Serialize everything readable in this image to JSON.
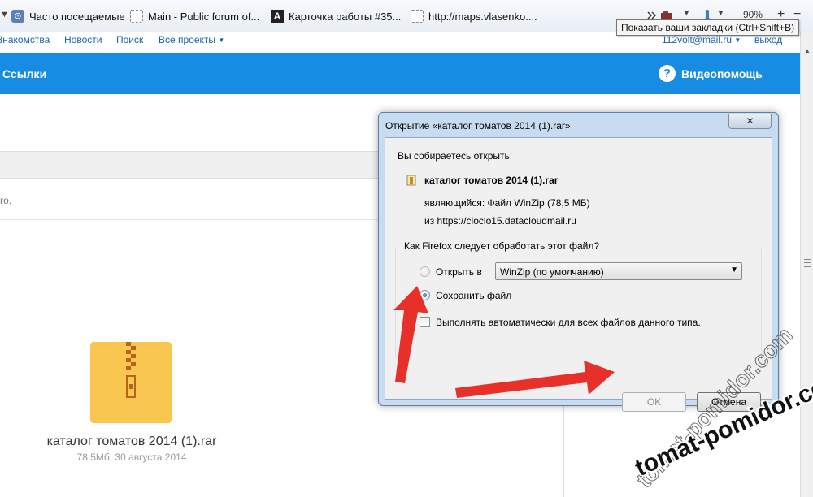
{
  "bookmarks_bar": {
    "items": [
      {
        "label": "Часто посещаемые",
        "icon": "most-visited-icon"
      },
      {
        "label": "Main - Public forum of...",
        "icon": "page-icon"
      },
      {
        "label": "Карточка работы #35...",
        "icon": "a-logo-icon"
      },
      {
        "label": "http://maps.vlasenko....",
        "icon": "page-icon"
      }
    ],
    "zoom": "90%",
    "tooltip": "Показать ваши закладки (Ctrl+Shift+B)"
  },
  "site_nav": {
    "items": [
      "Знакомства",
      "Новости",
      "Поиск",
      "Все проекты"
    ],
    "user_email": "112volt@mail.ru",
    "logout": "выход"
  },
  "blue_bar": {
    "section_title": "Ссылки",
    "help_icon_glyph": "?",
    "help_label": "Видеопомощь"
  },
  "page": {
    "fragment_text": "го.",
    "file_name": "каталог томатов 2014 (1).rar",
    "file_meta": "78.5Мб, 30 августа 2014"
  },
  "dialog": {
    "title": "Открытие «каталог томатов 2014 (1).rar»",
    "close_glyph": "✕",
    "intro": "Вы собираетесь открыть:",
    "file_name": "каталог томатов 2014 (1).rar",
    "type_line": "являющийся:  Файл WinZip (78,5 МБ)",
    "source_line": "из  https://cloclo15.datacloudmail.ru",
    "group_legend": "Как Firefox следует обработать этот файл?",
    "open_with_label": "Открыть в",
    "open_with_value": "WinZip (по умолчанию)",
    "save_label": "Сохранить файл",
    "auto_label": "Выполнять автоматически для всех файлов данного типа.",
    "ok_label": "OK",
    "cancel_label": "Отмена"
  },
  "colors": {
    "brand_blue": "#168de2",
    "arrow_red": "#e8302a",
    "rar_yellow": "#f9c74f"
  },
  "watermark": {
    "text": "tomat-pomidor.com"
  }
}
